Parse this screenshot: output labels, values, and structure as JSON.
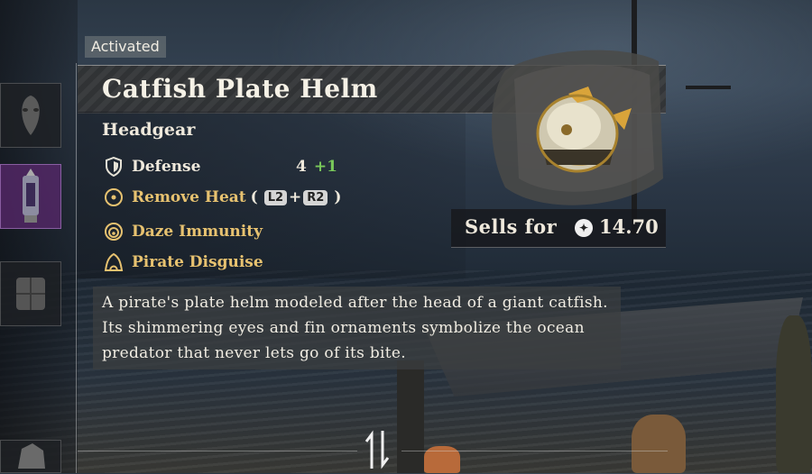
{
  "badge": "Activated",
  "item": {
    "name": "Catfish Plate Helm",
    "category": "Headgear",
    "stats": [
      {
        "icon": "shield-icon",
        "label": "Defense",
        "value": "4",
        "bonus": "+1"
      }
    ],
    "abilities": [
      {
        "icon": "circle-dot-icon",
        "label": "Remove Heat",
        "buttons": [
          "L2",
          "+",
          "R2"
        ],
        "paren_open": "(",
        "paren_close": ")"
      },
      {
        "icon": "spiral-icon",
        "label": "Daze Immunity"
      },
      {
        "icon": "hood-icon",
        "label": "Pirate Disguise"
      }
    ],
    "sells_label": "Sells for",
    "price": "14.70",
    "description": "A pirate's plate helm modeled after the head of a giant catfish. Its shimmering eyes and fin ornaments symbolize the ocean predator that never lets go of its bite."
  },
  "colors": {
    "gold": "#e7c270",
    "bonus": "#79c85a",
    "selected_slot": "#5a286e"
  },
  "equipment_slots": [
    {
      "icon": "mask-icon",
      "selected": false
    },
    {
      "icon": "lantern-helm-icon",
      "selected": true
    },
    {
      "icon": "armor-icon",
      "selected": false
    },
    {
      "icon": "rock-icon",
      "selected": false
    }
  ],
  "sort_icon": "swap-arrows-icon"
}
